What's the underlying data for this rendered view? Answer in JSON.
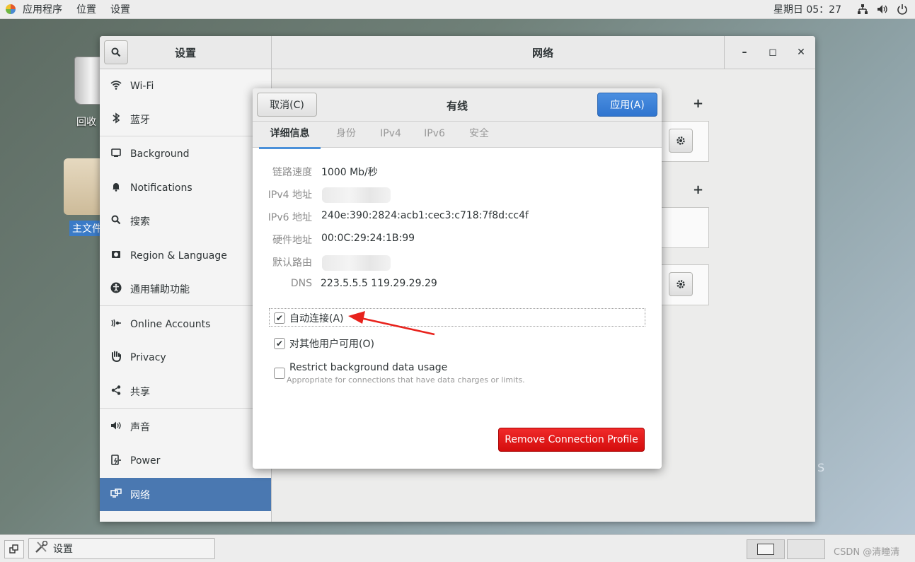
{
  "topbar": {
    "apps": "应用程序",
    "places": "位置",
    "settings": "设置",
    "clock": "星期日 05：27"
  },
  "desktop": {
    "trash_label": "回收",
    "home_label": "主文件",
    "edge_text": "S"
  },
  "window": {
    "sidebar_title": "设置",
    "main_title": "网络",
    "minimize": "–",
    "maximize": "◻",
    "close": "✕"
  },
  "sidebar": {
    "items": [
      {
        "label": "Wi-Fi",
        "icon": "wifi-icon"
      },
      {
        "label": "蓝牙",
        "icon": "bluetooth-icon"
      },
      {
        "label": "Background",
        "icon": "background-icon"
      },
      {
        "label": "Notifications",
        "icon": "bell-icon"
      },
      {
        "label": "搜索",
        "icon": "search-icon"
      },
      {
        "label": "Region & Language",
        "icon": "region-icon"
      },
      {
        "label": "通用辅助功能",
        "icon": "accessibility-icon"
      },
      {
        "label": "Online Accounts",
        "icon": "online-accounts-icon"
      },
      {
        "label": "Privacy",
        "icon": "hand-icon"
      },
      {
        "label": "共享",
        "icon": "share-icon"
      },
      {
        "label": "声音",
        "icon": "speaker-icon"
      },
      {
        "label": "Power",
        "icon": "power-icon"
      },
      {
        "label": "网络",
        "icon": "network-icon"
      }
    ],
    "active_index": 12
  },
  "content": {
    "plus": "+"
  },
  "dialog": {
    "cancel": "取消(C)",
    "title": "有线",
    "apply": "应用(A)",
    "tabs": [
      "详细信息",
      "身份",
      "IPv4",
      "IPv6",
      "安全"
    ],
    "active_tab": 0,
    "details": {
      "link_speed_label": "链路速度",
      "link_speed": "1000 Mb/秒",
      "ipv4_label": "IPv4 地址",
      "ipv6_label": "IPv6 地址",
      "ipv6": "240e:390:2824:acb1:cec3:c718:7f8d:cc4f",
      "hw_label": "硬件地址",
      "hw": "00:0C:29:24:1B:99",
      "route_label": "默认路由",
      "dns_label": "DNS",
      "dns": "223.5.5.5 119.29.29.29"
    },
    "auto_connect": "自动连接(A)",
    "auto_connect_checked": true,
    "all_users": "对其他用户可用(O)",
    "all_users_checked": true,
    "restrict": "Restrict background data usage",
    "restrict_checked": false,
    "restrict_hint": "Appropriate for connections that have data charges or limits.",
    "remove": "Remove Connection Profile"
  },
  "taskbar": {
    "task_label": "设置",
    "watermark": "CSDN @清瞳清"
  },
  "colors": {
    "accent": "#4a90d9",
    "active_sidebar": "#4a78b1",
    "danger": "#e01b1b",
    "arrow": "#e8221c"
  }
}
